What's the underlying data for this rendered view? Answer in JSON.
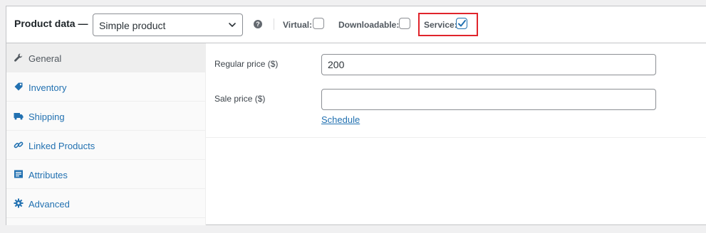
{
  "header": {
    "title": "Product data —",
    "product_type": {
      "selected": "Simple product",
      "options": [
        "Simple product"
      ]
    },
    "help_icon": "question-icon",
    "options": [
      {
        "label": "Virtual:",
        "checked": false
      },
      {
        "label": "Downloadable:",
        "checked": false
      },
      {
        "label": "Service:",
        "checked": true
      }
    ]
  },
  "tabs": [
    {
      "label": "General",
      "icon": "wrench-icon",
      "active": true
    },
    {
      "label": "Inventory",
      "icon": "tag-icon",
      "active": false
    },
    {
      "label": "Shipping",
      "icon": "truck-icon",
      "active": false
    },
    {
      "label": "Linked Products",
      "icon": "link-icon",
      "active": false
    },
    {
      "label": "Attributes",
      "icon": "list-icon",
      "active": false
    },
    {
      "label": "Advanced",
      "icon": "gear-icon",
      "active": false
    }
  ],
  "general": {
    "regular_price_label": "Regular price ($)",
    "regular_price_value": "200",
    "sale_price_label": "Sale price ($)",
    "sale_price_value": "",
    "schedule_label": "Schedule"
  },
  "colors": {
    "link": "#2271b1",
    "highlight": "#e0242b",
    "active_tab_bg": "#eeeeee"
  }
}
